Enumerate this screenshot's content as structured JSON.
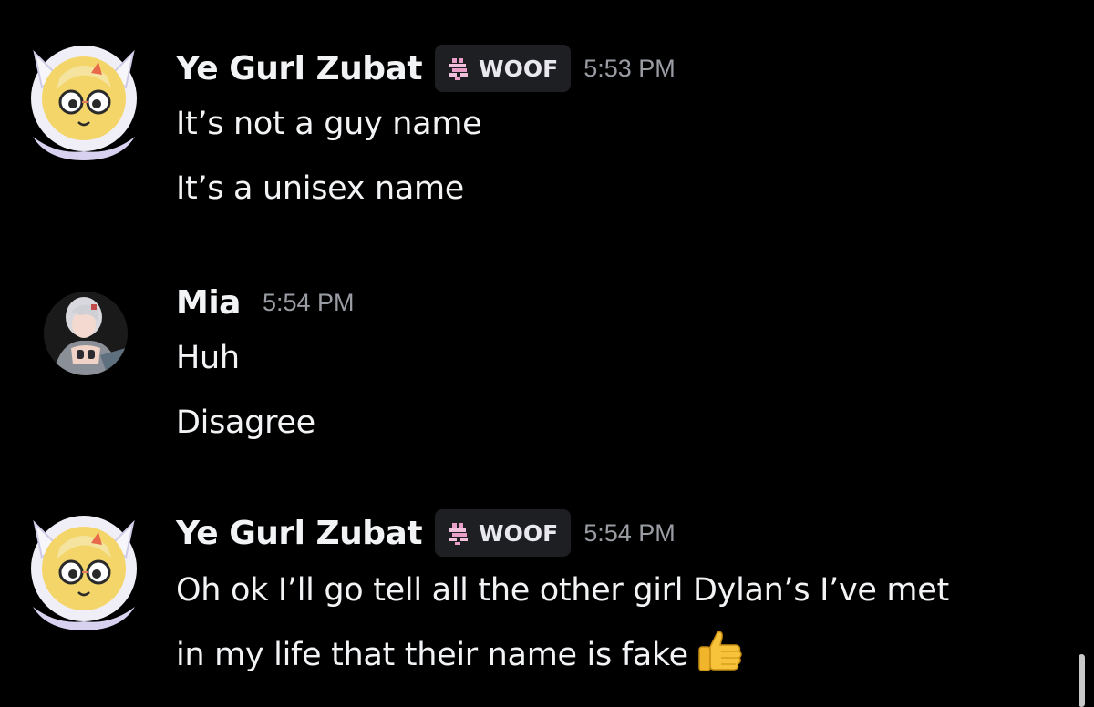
{
  "messages": [
    {
      "username": "Ye Gurl Zubat",
      "tag": {
        "icon": "pixel-sprite-icon",
        "label": "WOOF"
      },
      "time": "5:53 PM",
      "lines": [
        "It’s not a guy name",
        "It’s a unisex name"
      ]
    },
    {
      "username": "Mia",
      "time": "5:54 PM",
      "lines": [
        "Huh",
        "Disagree"
      ]
    },
    {
      "username": "Ye Gurl Zubat",
      "tag": {
        "icon": "pixel-sprite-icon",
        "label": "WOOF"
      },
      "time": "5:54 PM",
      "lines": [
        "Oh ok I’ll go tell all the other girl Dylan’s I’ve met",
        "in my life that their name is fake"
      ],
      "emoji": "👍"
    }
  ],
  "colors": {
    "background": "#000000",
    "text": "#f2f3f5",
    "timestamp": "#9a9ca3",
    "tag_background": "#1e1f22",
    "tag_icon": "#e8a0c8"
  }
}
